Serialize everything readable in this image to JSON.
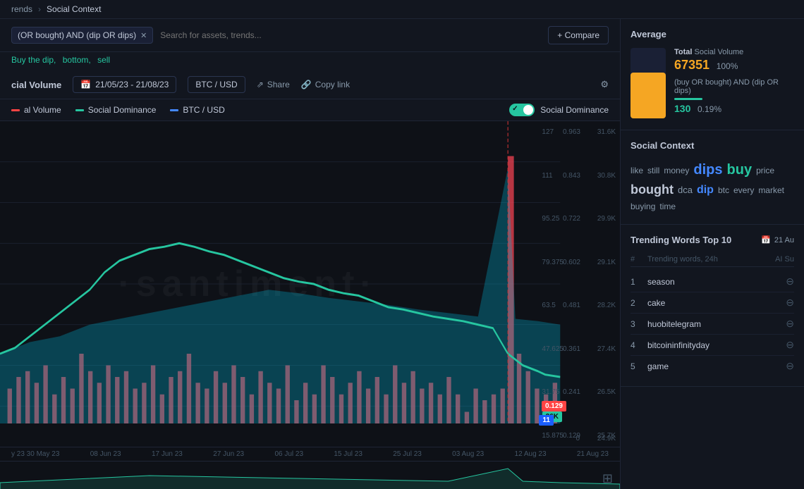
{
  "topbar": {
    "breadcrumb1": "rends",
    "arrow": "›",
    "breadcrumb2": "Social Context"
  },
  "searchbar": {
    "filter_tag": "(OR bought) AND (dip OR dips)",
    "placeholder": "Search for assets, trends...",
    "compare_label": "+ Compare"
  },
  "tags": {
    "links": [
      "Buy the dip,",
      "bottom,",
      "sell"
    ]
  },
  "chart_header": {
    "title": "cial Volume",
    "date_range": "21/05/23 - 21/08/23",
    "asset_pair": "BTC / USD",
    "share": "Share",
    "copy_link": "Copy link"
  },
  "legend": {
    "item1": "al Volume",
    "item2": "Social Dominance",
    "item3": "BTC / USD",
    "toggle": "Social Dominance"
  },
  "chart": {
    "watermark": "·santiment·",
    "y_left": [
      "127",
      "111",
      "95.25",
      "79.375",
      "63.5",
      "47.625",
      "31.75",
      "15.875"
    ],
    "y_middle": [
      "0.963",
      "0.843",
      "0.722",
      "0.602",
      "0.481",
      "0.361",
      "0.241",
      "0.129"
    ],
    "y_right": [
      "31.6K",
      "30.8K",
      "29.9K",
      "29.1K",
      "28.2K",
      "27.4K",
      "26.5K",
      "25.7K"
    ],
    "tooltip_green": "26K",
    "tooltip_red": "0.129",
    "tooltip_blue": "11"
  },
  "xaxis": {
    "labels": [
      "y 23 30 May 23",
      "08 Jun 23",
      "17 Jun 23",
      "27 Jun 23",
      "06 Jul 23",
      "15 Jul 23",
      "25 Jul 23",
      "03 Aug 23",
      "12 Aug 23",
      "21 Aug 23"
    ]
  },
  "right_panel": {
    "average_title": "Average",
    "avg_bar_height": "65%",
    "total_label": "Total",
    "social_volume": "Social Volume",
    "total_value": "67351",
    "total_pct": "100%",
    "sub_desc": "(buy OR bought) AND (dip OR dips)",
    "sub_value": "130",
    "sub_pct": "0.19%",
    "social_context_title": "Social Context",
    "words": [
      {
        "text": "like",
        "size": "sm"
      },
      {
        "text": "still",
        "size": "sm"
      },
      {
        "text": "money",
        "size": "sm"
      },
      {
        "text": "dips",
        "size": "lg"
      },
      {
        "text": "buy",
        "size": "lg"
      },
      {
        "text": "price",
        "size": "sm"
      },
      {
        "text": "bought",
        "size": "bought"
      },
      {
        "text": "dca",
        "size": "dca"
      },
      {
        "text": "dip",
        "size": "dip"
      },
      {
        "text": "btc",
        "size": "sm"
      },
      {
        "text": "every",
        "size": "sm"
      },
      {
        "text": "market",
        "size": "sm"
      },
      {
        "text": "buying",
        "size": "sm"
      },
      {
        "text": "time",
        "size": "sm"
      }
    ],
    "trending_title": "Trending Words Top 10",
    "trending_date": "21 Au",
    "col_hash": "#",
    "col_word": "Trending words, 24h",
    "col_ai": "AI Su",
    "trending_rows": [
      {
        "num": "1",
        "word": "season"
      },
      {
        "num": "2",
        "word": "cake"
      },
      {
        "num": "3",
        "word": "huobitelegram"
      },
      {
        "num": "4",
        "word": "bitcoininfinityda"
      },
      {
        "num": "5",
        "word": "game"
      }
    ]
  }
}
